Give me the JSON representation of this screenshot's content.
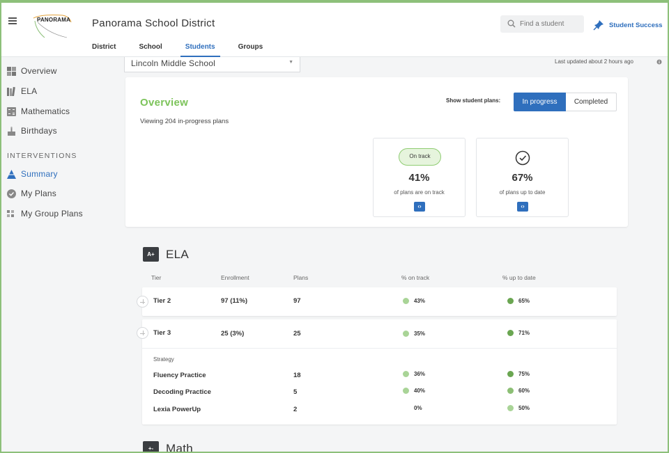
{
  "header": {
    "logo_text": "PANORAMA",
    "district_name": "Panorama School District",
    "search_placeholder": "Find a student",
    "student_success": "Student Success",
    "nav": [
      "District",
      "School",
      "Students",
      "Groups"
    ],
    "active_nav": "Students"
  },
  "sidebar": {
    "items": [
      "Overview",
      "ELA",
      "Mathematics",
      "Birthdays"
    ],
    "interventions_heading": "INTERVENTIONS",
    "intervention_items": [
      "Summary",
      "My Plans",
      "My Group Plans"
    ]
  },
  "school_select": "Lincoln Middle School",
  "last_updated": "Last updated about 2 hours ago",
  "overview": {
    "title": "Overview",
    "subtitle": "Viewing 204 in-progress plans",
    "show_label": "Show student plans:",
    "toggle_on": "In progress",
    "toggle_off": "Completed",
    "ontrack_badge": "On track",
    "ontrack_pct": "41%",
    "ontrack_caption": "of plans are on track",
    "uptodate_pct": "67%",
    "uptodate_caption": "of plans up to date",
    "expand_symbol": "‹›"
  },
  "ela": {
    "badge": "A+",
    "title": "ELA",
    "columns": [
      "Tier",
      "Enrollment",
      "Plans",
      "% on track",
      "% up to date"
    ],
    "tiers": [
      {
        "tier": "Tier 2",
        "enrollment": "97 (11%)",
        "plans": "97",
        "on_track": "43%",
        "up_to_date": "65%"
      },
      {
        "tier": "Tier 3",
        "enrollment": "25 (3%)",
        "plans": "25",
        "on_track": "35%",
        "up_to_date": "71%"
      }
    ],
    "strategy_label": "Strategy",
    "strategies": [
      {
        "name": "Fluency Practice",
        "plans": "18",
        "on_track": "36%",
        "up_to_date": "75%"
      },
      {
        "name": "Decoding Practice",
        "plans": "5",
        "on_track": "40%",
        "up_to_date": "60%"
      },
      {
        "name": "Lexia PowerUp",
        "plans": "2",
        "on_track": "0%",
        "up_to_date": "50%"
      }
    ]
  },
  "math": {
    "badge": "+-",
    "title": "Math"
  },
  "colors": {
    "accent_blue": "#2f6fbd",
    "overview_green": "#7cc35a",
    "dot_light": "#a9d497",
    "dot_dark": "#6aa651"
  }
}
